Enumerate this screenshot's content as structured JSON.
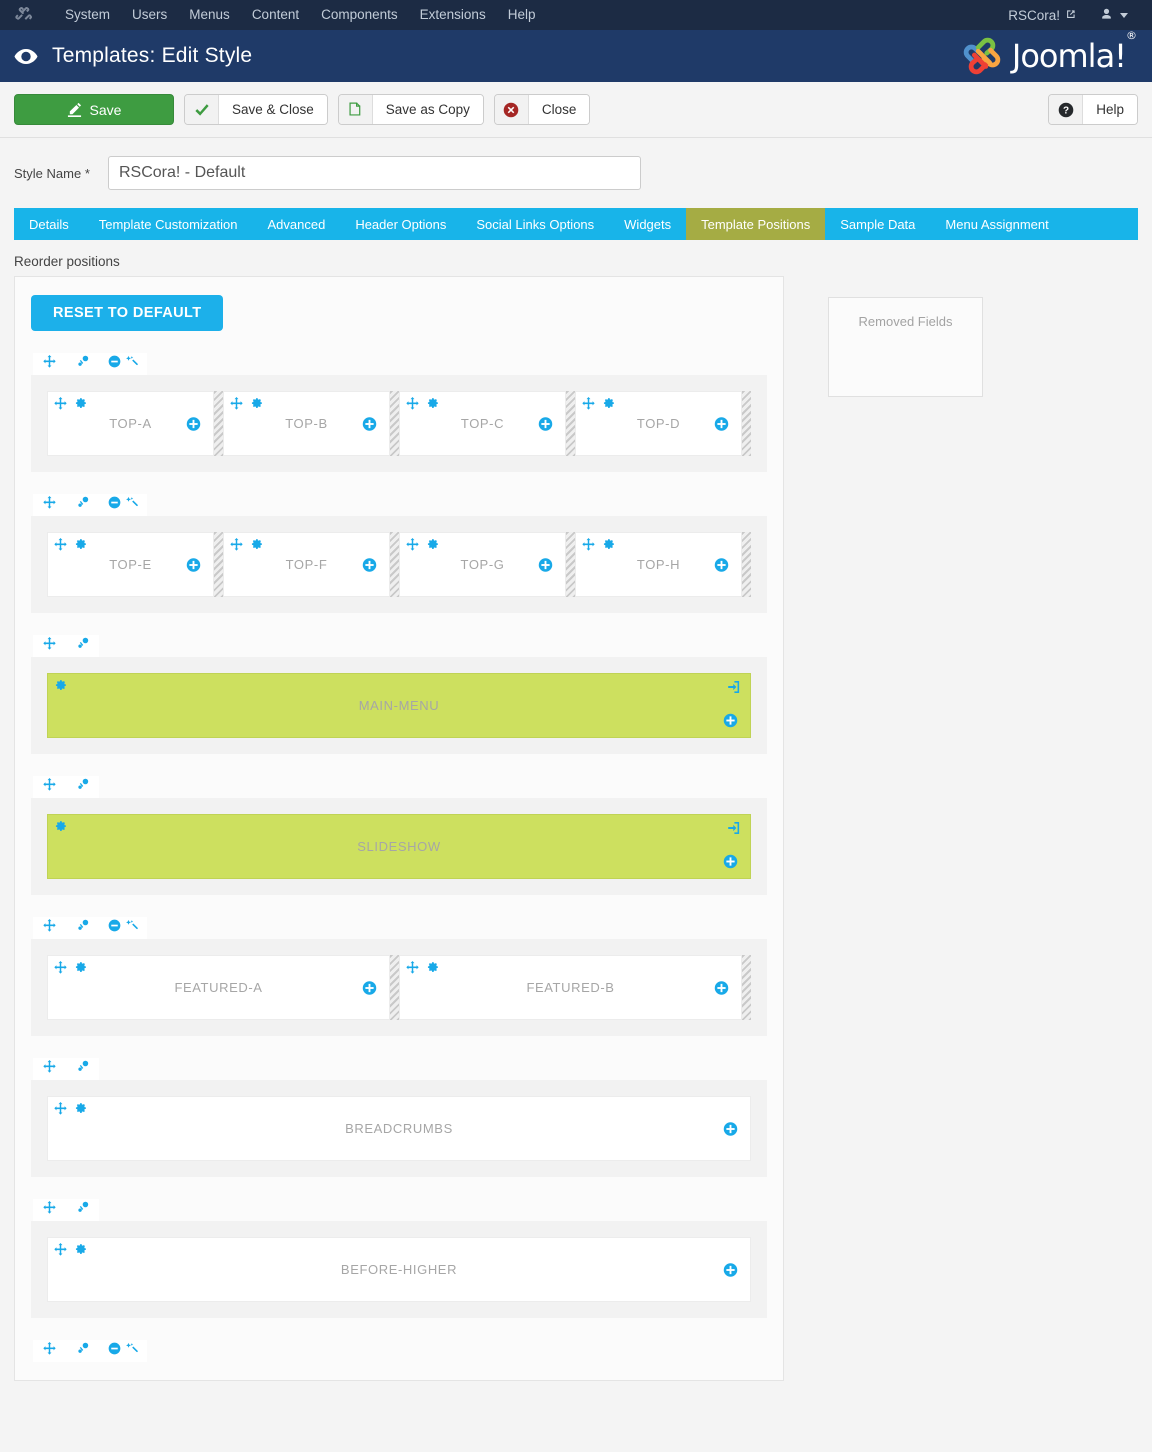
{
  "admin_bar": {
    "logo_icon": "joomla-logo-icon",
    "menu": [
      {
        "label": "System"
      },
      {
        "label": "Users"
      },
      {
        "label": "Menus"
      },
      {
        "label": "Content"
      },
      {
        "label": "Components"
      },
      {
        "label": "Extensions"
      },
      {
        "label": "Help"
      }
    ],
    "site_name": "RSCora!",
    "site_name_icon": "external-link-icon",
    "user_icon": "user-icon",
    "caret_icon": "chevron-down-icon"
  },
  "header": {
    "icon": "eye-icon",
    "title": "Templates: Edit Style",
    "brand": "Joomla!",
    "brand_sup": "®",
    "brand_icon": "joomla-brand-icon"
  },
  "toolbar": {
    "save_label": "Save",
    "save_icon": "edit-save-icon",
    "save_close_label": "Save & Close",
    "save_close_icon": "check-icon",
    "save_copy_label": "Save as Copy",
    "save_copy_icon": "copy-icon",
    "close_label": "Close",
    "close_icon": "close-circle-icon",
    "help_label": "Help",
    "help_icon": "question-circle-icon"
  },
  "form": {
    "style_name_label": "Style Name",
    "style_name_required": "*",
    "style_name_value": "RSCora! - Default",
    "style_name_placeholder": "Style Name"
  },
  "tabs": [
    {
      "label": "Details",
      "active": false
    },
    {
      "label": "Template Customization",
      "active": false
    },
    {
      "label": "Advanced",
      "active": false
    },
    {
      "label": "Header Options",
      "active": false
    },
    {
      "label": "Social Links Options",
      "active": false
    },
    {
      "label": "Widgets",
      "active": false
    },
    {
      "label": "Template Positions",
      "active": true
    },
    {
      "label": "Sample Data",
      "active": false
    },
    {
      "label": "Menu Assignment",
      "active": false
    }
  ],
  "builder": {
    "section_label": "Reorder positions",
    "reset_button": "RESET TO DEFAULT",
    "removed_fields_label": "Removed Fields"
  },
  "colors": {
    "admin_bar_bg": "#1c2b44",
    "header_bg": "#1f3a68",
    "tab_bg": "#18b4e9",
    "tab_active_bg": "#a5ac44",
    "accent_blue": "#18a9e8",
    "reset_btn": "#1cb0ea",
    "save_green": "#3e9c41",
    "position_green": "#cde05f",
    "label_grey": "#a6a6a6"
  },
  "rows": [
    {
      "tools": [
        "move-icon",
        "link-icon",
        "minus-circle-icon",
        "wand-icon"
      ],
      "blocks": [
        {
          "label": "TOP-A",
          "green": false,
          "grip": true,
          "has_exit": false
        },
        {
          "label": "TOP-B",
          "green": false,
          "grip": true,
          "has_exit": false
        },
        {
          "label": "TOP-C",
          "green": false,
          "grip": true,
          "has_exit": false
        },
        {
          "label": "TOP-D",
          "green": false,
          "grip": true,
          "has_exit": false
        }
      ]
    },
    {
      "tools": [
        "move-icon",
        "link-icon",
        "minus-circle-icon",
        "wand-icon"
      ],
      "blocks": [
        {
          "label": "TOP-E",
          "green": false,
          "grip": true,
          "has_exit": false
        },
        {
          "label": "TOP-F",
          "green": false,
          "grip": true,
          "has_exit": false
        },
        {
          "label": "TOP-G",
          "green": false,
          "grip": true,
          "has_exit": false
        },
        {
          "label": "TOP-H",
          "green": false,
          "grip": true,
          "has_exit": false
        }
      ]
    },
    {
      "tools": [
        "move-icon",
        "link-icon"
      ],
      "blocks": [
        {
          "label": "MAIN-MENU",
          "green": true,
          "grip": false,
          "has_exit": true
        }
      ]
    },
    {
      "tools": [
        "move-icon",
        "link-icon"
      ],
      "blocks": [
        {
          "label": "SLIDESHOW",
          "green": true,
          "grip": false,
          "has_exit": true
        }
      ]
    },
    {
      "tools": [
        "move-icon",
        "link-icon",
        "minus-circle-icon",
        "wand-icon"
      ],
      "blocks": [
        {
          "label": "FEATURED-A",
          "green": false,
          "grip": true,
          "has_exit": false
        },
        {
          "label": "FEATURED-B",
          "green": false,
          "grip": true,
          "has_exit": false
        }
      ]
    },
    {
      "tools": [
        "move-icon",
        "link-icon"
      ],
      "blocks": [
        {
          "label": "BREADCRUMBS",
          "green": false,
          "grip": false,
          "has_exit": false
        }
      ]
    },
    {
      "tools": [
        "move-icon",
        "link-icon"
      ],
      "blocks": [
        {
          "label": "BEFORE-HIGHER",
          "green": false,
          "grip": false,
          "has_exit": false
        }
      ]
    },
    {
      "tools": [
        "move-icon",
        "link-icon",
        "minus-circle-icon",
        "wand-icon"
      ],
      "blocks": []
    }
  ]
}
